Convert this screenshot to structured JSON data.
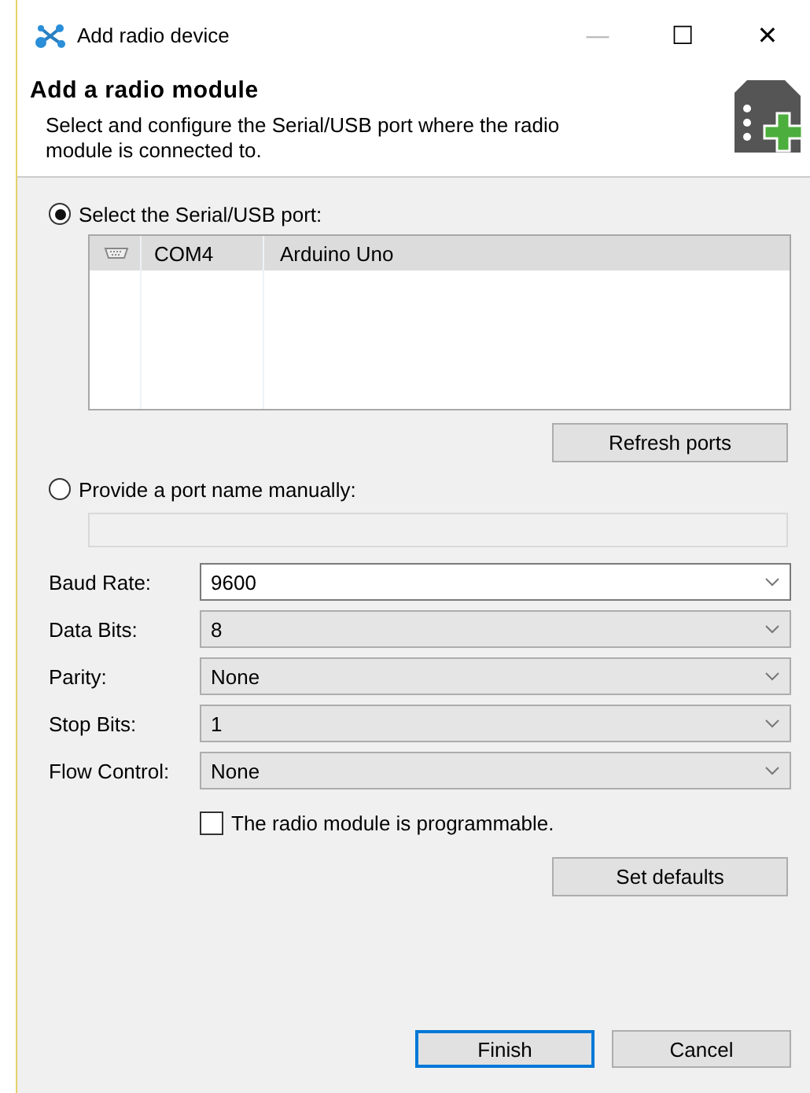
{
  "window": {
    "title": "Add radio device",
    "controls": [
      "—",
      "☐",
      "✕"
    ]
  },
  "header": {
    "title": "Add a radio module",
    "description": "Select and configure the Serial/USB port where the radio module is connected to."
  },
  "port_options": [
    {
      "label": "Select the Serial/USB port:",
      "selected": true
    },
    {
      "label": "Provide a port name manually:",
      "selected": false
    }
  ],
  "ports": [
    {
      "port": "COM4",
      "device": "Arduino Uno",
      "selected": true
    }
  ],
  "refresh_button": "Refresh ports",
  "manual_port": {
    "disabled": true
  },
  "settings": [
    {
      "label": "Baud Rate:",
      "value": "9600",
      "editable": true
    },
    {
      "label": "Data Bits:",
      "value": "8",
      "editable": false
    },
    {
      "label": "Parity:",
      "value": "None",
      "editable": false
    },
    {
      "label": "Stop Bits:",
      "value": "1",
      "editable": false
    },
    {
      "label": "Flow Control:",
      "value": "None",
      "editable": false
    }
  ],
  "programmable": {
    "label": "The radio module is programmable.",
    "checked": false
  },
  "defaults_button": "Set defaults",
  "buttons": [
    {
      "label": "Finish",
      "default": true
    },
    {
      "label": "Cancel",
      "default": false
    }
  ]
}
